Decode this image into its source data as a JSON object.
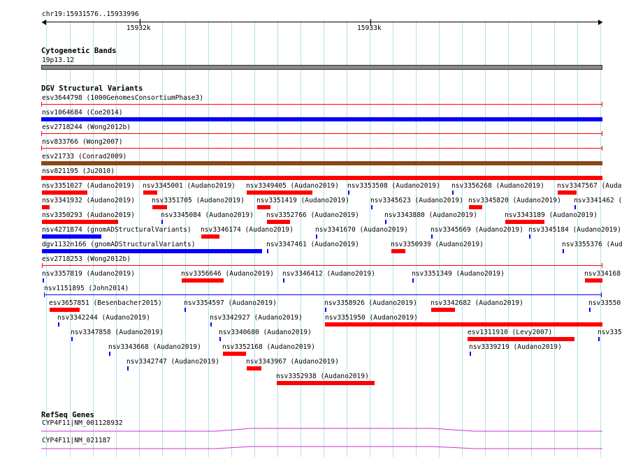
{
  "location": "chr19:15931576..15933996",
  "ruler_ticks": [
    "15932k",
    "15933k"
  ],
  "tracks": {
    "cyto": {
      "title": "Cytogenetic Bands",
      "band": "19p13.12"
    },
    "dgv": {
      "title": "DGV Structural Variants",
      "features": [
        "esv3644798 (1000GenomesConsortiumPhase3)",
        "nsv1064684 (Coe2014)",
        "esv2718244 (Wong2012b)",
        "nsv833766 (Wong2007)",
        "esv21733 (Conrad2009)",
        "nsv821195 (Ju2010)",
        "nsv3351027 (Audano2019)",
        "nsv3345001 (Audano2019)",
        "nsv3349405 (Audano2019)",
        "nsv3353508 (Audano2019)",
        "nsv3356268 (Audano2019)",
        "nsv3347567 (Audan",
        "nsv3341932 (Audano2019)",
        "nsv3351705 (Audano2019)",
        "nsv3351419 (Audano2019)",
        "nsv3345623 (Audano2019)",
        "nsv3345820 (Audano2019)",
        "nsv3341462 (",
        "nsv3350293 (Audano2019)",
        "nsv3345084 (Audano2019)",
        "nsv3352766 (Audano2019)",
        "nsv3343880 (Audano2019)",
        "nsv3343189 (Audano2019)",
        "nsv4271874 (gnomADStructuralVariants)",
        "nsv3346174 (Audano2019)",
        "nsv3341670 (Audano2019)",
        "nsv3345669 (Audano2019)",
        "nsv3345184 (Audano2019)",
        "dgv1132n166 (gnomADStructuralVariants)",
        "nsv3347461 (Audano2019)",
        "nsv3350939 (Audano2019)",
        "nsv3355376 (Aud",
        "esv2718253 (Wong2012b)",
        "nsv3357819 (Audano2019)",
        "nsv3356646 (Audano2019)",
        "nsv3346412 (Audano2019)",
        "nsv3351349 (Audano2019)",
        "nsv334168",
        "nsv1151895 (John2014)",
        "esv3657851 (Besenbacher2015)",
        "nsv3354597 (Audano2019)",
        "nsv3358926 (Audano2019)",
        "nsv3342682 (Audano2019)",
        "nsv33550",
        "nsv3342244 (Audano2019)",
        "nsv3342927 (Audano2019)",
        "nsv3351950 (Audano2019)",
        "nsv3347858 (Audano2019)",
        "nsv3340680 (Audano2019)",
        "esv1311910 (Levy2007)",
        "nsv335",
        "nsv3343668 (Audano2019)",
        "nsv3352168 (Audano2019)",
        "nsv3339219 (Audano2019)",
        "nsv3342747 (Audano2019)",
        "nsv3343967 (Audano2019)",
        "nsv3352938 (Audano2019)"
      ]
    },
    "refseq": {
      "title": "RefSeq Genes",
      "genes": [
        "CYP4F11|NM_001128932",
        "CYP4F11|NM_021187"
      ]
    }
  },
  "colors": {
    "loss": "#ff0000",
    "gain": "#0000ff",
    "complex": "#8b4513",
    "gene": "#cc33cc",
    "grid": "#b3e0ec"
  }
}
